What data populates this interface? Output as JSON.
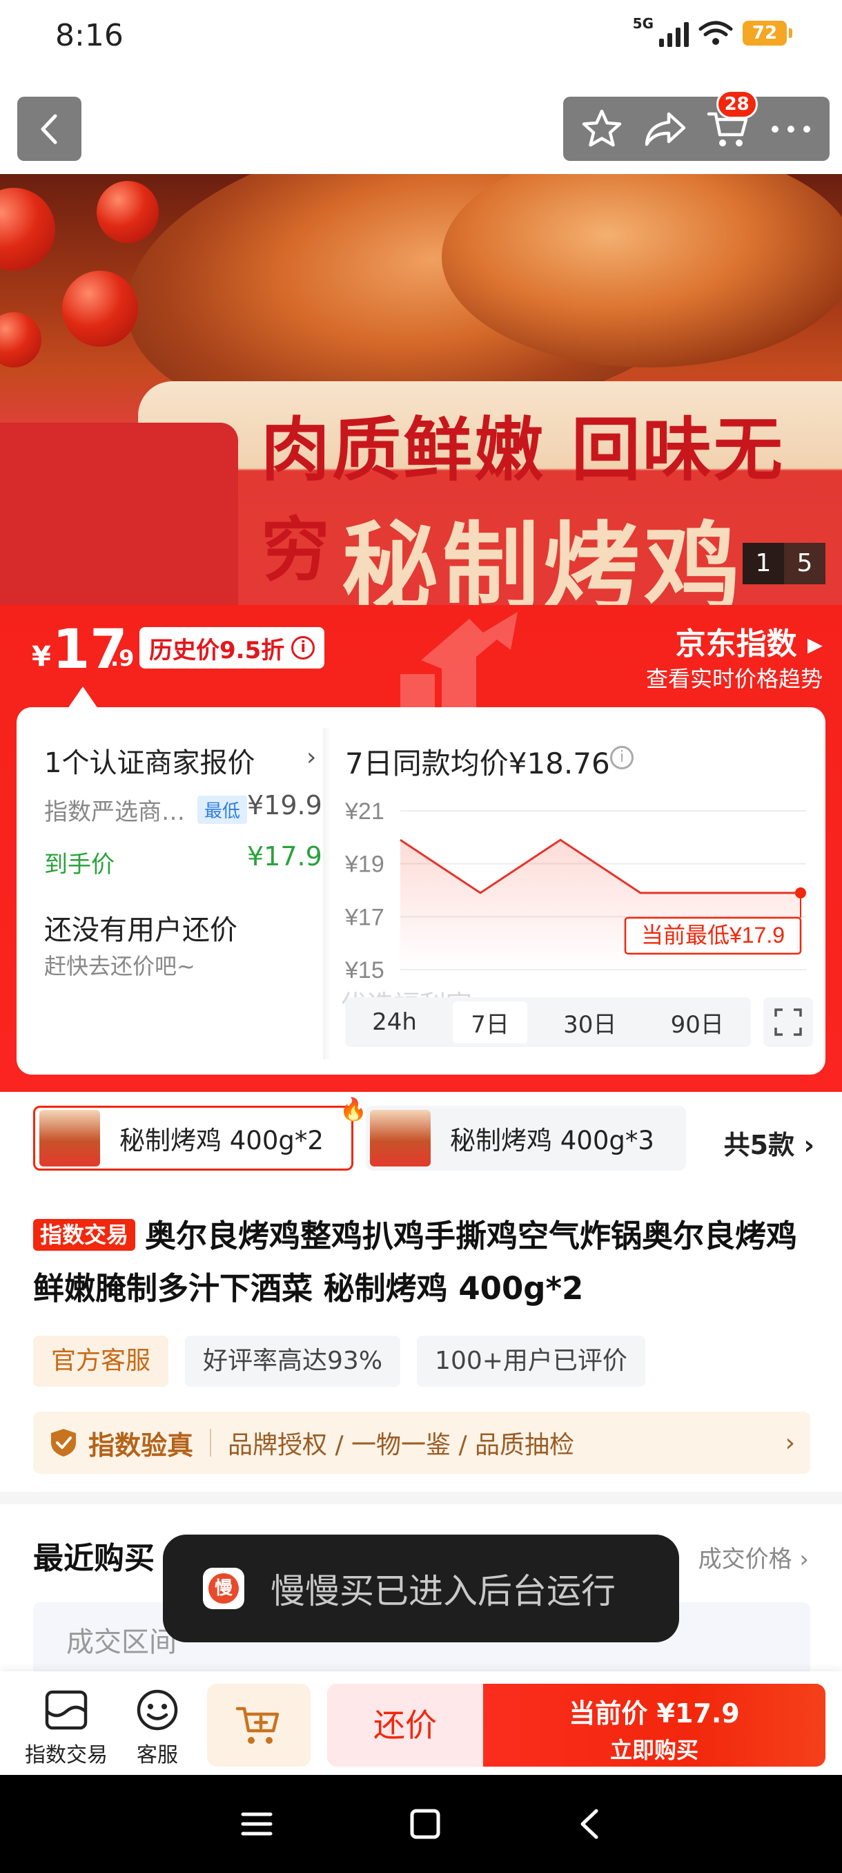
{
  "status_bar": {
    "time": "8:16",
    "network": "5G",
    "battery": "72"
  },
  "header": {
    "cart_count": "28"
  },
  "hero": {
    "slogan_top": "肉质鲜嫩 回味无穷",
    "slogan_main": "秘制烤鸡",
    "page_current": "1",
    "page_total": "5"
  },
  "price": {
    "currency": "¥",
    "integer": "17",
    "decimal": ".9",
    "history_badge": "历史价9.5折",
    "jd_index": "京东指数 ▸",
    "jd_index_sub": "查看实时价格趋势"
  },
  "merchant": {
    "title": "1个认证商家报价",
    "row1_label": "指数严选商…",
    "row1_tag": "最低",
    "row1_price": "¥19.9",
    "row2_label": "到手价",
    "row2_price": "¥17.9",
    "haggle_title": "还没有用户还价",
    "haggle_sub": "赶快去还价吧~"
  },
  "trend": {
    "title": "7日同款均价¥18.76",
    "watermark": "优选福利官",
    "current_low_label": "当前最低¥17.9",
    "tabs": [
      "24h",
      "7日",
      "30日",
      "90日"
    ],
    "active_tab": "7日"
  },
  "chart_data": {
    "type": "line",
    "title": "7日同款均价¥18.76",
    "y_ticks": [
      "¥21",
      "¥19",
      "¥17",
      "¥15"
    ],
    "ylim": [
      15,
      21
    ],
    "x": [
      0,
      1,
      2,
      3,
      4,
      5
    ],
    "values": [
      19.9,
      17.9,
      19.9,
      17.9,
      17.9,
      17.9
    ],
    "annotation": "当前最低¥17.9",
    "grid": true
  },
  "variants": {
    "items": [
      {
        "label": "秘制烤鸡 400g*2",
        "selected": true
      },
      {
        "label": "秘制烤鸡 400g*3",
        "selected": false
      }
    ],
    "more": "共5款 ›"
  },
  "product": {
    "tag": "指数交易",
    "title": "奥尔良烤鸡整鸡扒鸡手撕鸡空气炸锅奥尔良烤鸡鲜嫩腌制多汁下酒菜 秘制烤鸡 400g*2",
    "chips": [
      "官方客服",
      "好评率高达93%",
      "100+用户已评价"
    ],
    "verify_title": "指数验真",
    "verify_sub": "品牌授权 / 一物一鉴 / 品质抽检"
  },
  "recent": {
    "title": "最近购买",
    "right": "成交价格",
    "range": "成交区间"
  },
  "toast": {
    "icon": "慢",
    "text": "慢慢买已进入后台运行"
  },
  "bottom_bar": {
    "index_trade": "指数交易",
    "service": "客服",
    "haggle": "还价",
    "buy_line1": "当前价 ¥17.9",
    "buy_line2": "立即购买"
  },
  "colors": {
    "accent": "#f2270c",
    "green": "#29a33a",
    "gold": "#b4631a"
  }
}
